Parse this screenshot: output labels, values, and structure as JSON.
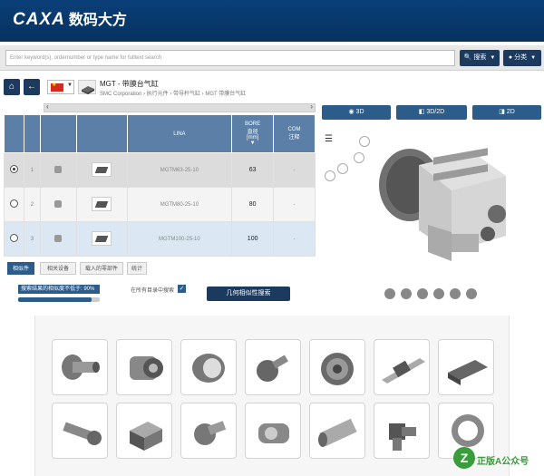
{
  "app": {
    "logo_latin": "CAXA",
    "logo_cn": "数码大方"
  },
  "search": {
    "placeholder": "Enter keyword(s), ordernumber or type name for fulltext search",
    "search_label": "搜索",
    "category_label": "分类"
  },
  "product": {
    "title": "MGT - 带膜台气缸",
    "breadcrumb": "SMC Corporation  ›  执行元件  ›  带导杆气缸  ›  MGT 带膜台气缸"
  },
  "view_buttons": [
    "3D",
    "3D/2D",
    "2D"
  ],
  "table": {
    "headers": {
      "lina": "LINA",
      "bore_line1": "BORE",
      "bore_line2": "直径",
      "bore_unit": "[mm]",
      "com_line1": "COM",
      "com_line2": "注释"
    },
    "rows": [
      {
        "index": "1",
        "lina": "MGTM63-25-10",
        "bore": "63",
        "com": "-"
      },
      {
        "index": "2",
        "lina": "MGTM80-25-10",
        "bore": "80",
        "com": "-"
      },
      {
        "index": "3",
        "lina": "MGTM100-25-10",
        "bore": "100",
        "com": "-"
      }
    ]
  },
  "tabs": [
    "相似件",
    "相关设备",
    "载入的零部件",
    "统计"
  ],
  "similarity": {
    "label": "搜索结果的相似度不低于: 90%",
    "value_percent": 90,
    "checkbox_label": "在所有目录中搜索",
    "geo_button": "几何相似性搜索"
  },
  "watermark": {
    "icon": "Z",
    "text": "正版A公众号"
  },
  "colors": {
    "header": "#0a3f78",
    "accent": "#2b5c8a",
    "table_header": "#5b7fa6"
  }
}
